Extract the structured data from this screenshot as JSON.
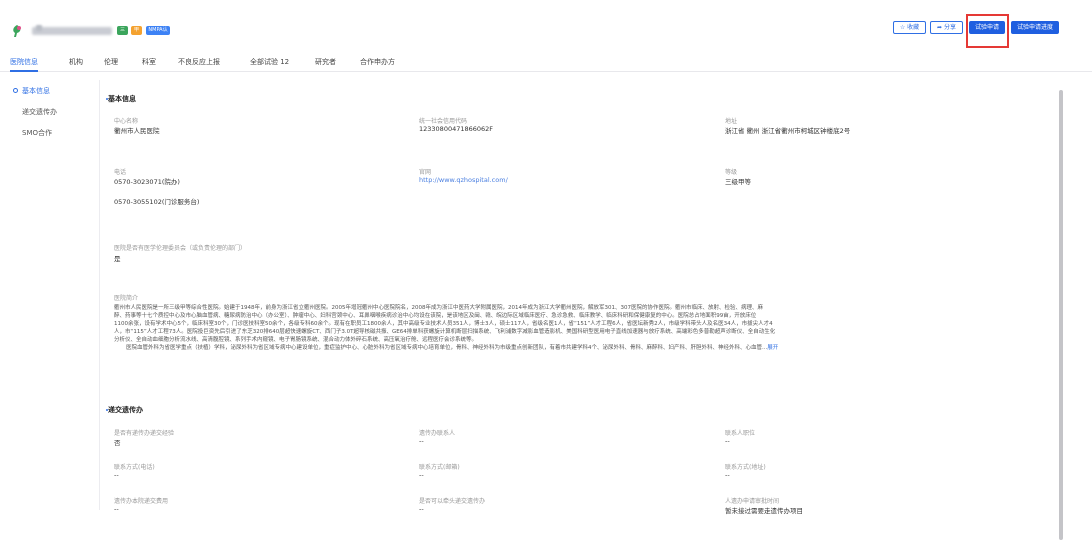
{
  "header": {
    "badges": [
      "三级",
      "甲等",
      "NMPA认定"
    ],
    "buttons": {
      "favorite": "☆ 收藏",
      "share": "➦ 分享",
      "apply": "试验申请",
      "progress": "试验申请进度"
    }
  },
  "tabs": [
    "医院信息",
    "机构",
    "伦理",
    "科室",
    "不良反应上报",
    "全部试验 12",
    "研究者",
    "合作申办方"
  ],
  "sidebar": [
    "基本信息",
    "递交遗传办",
    "SMO合作"
  ],
  "basic": {
    "title": "基本信息",
    "name_label": "中心名称",
    "name_value": "衢州市人民医院",
    "credit_label": "统一社会信用代码",
    "credit_value": "12330800471866062F",
    "address_label": "地址",
    "address_value": "浙江省 衢州 浙江省衢州市柯城区钟楼底2号",
    "phone_label": "电话",
    "phone_value1": "0570-3023071(院办)",
    "phone_value2": "0570-3055102(门诊服务台)",
    "website_label": "官网",
    "website_value": "http://www.qzhospital.com/",
    "level_label": "等级",
    "level_value": "三级甲等",
    "ethics_label": "医院是否有医学伦理委员会（或负责伦理的部门）",
    "ethics_value": "是",
    "intro_label": "医院简介",
    "intro_lines": [
      "衢州市人民医院是一所三级甲等综合性医院。始建于1948年，前身为浙江省立衢州医院。2005年增冠衢州中心医院院名，2008年成为浙江中医药大学附属医院，2014年成为浙江大学衢州医院，解放军301、307医院的协作医院。衢州市临床、放射、检验、病理、麻",
      "醉、药事等十七个质控中心及市心脑血管病、糖尿病防治中心（办公室）、肿瘤中心、妇科宫颈中心、耳鼻咽喉疾病诊治中心均设在该院，是该地区及闽、赣、皖边际区域临床医疗、急诊急救、临床教学、临床科研和保健康复的中心。医院总占地面积99亩，开放床位",
      "1100余张，设有学术中心5个，临床科室30个，门诊医技科室50余个，各级专科60余个。现有在职员工1800余人，其中高级专业技术人员351人，博士3人，硕士117人，省级名医1人，省“151”人才工程6人，省医坛新秀2人，市级学科带头人及名医34人，市拔尖人才4",
      "人，市“115”人才工程73人。医院投巨资先后引进了东芝320排640层超快速螺旋CT、西门子3.0T超导核磁共振、GE64排单科获螺旋计算机断层扫描系统、飞利浦数字减影血管造影机、美国科研型医用电子直线加速器与放疗系统、高端彩色多普勒超声诊断仪、全自动生化",
      "分析仪、全自动血细胞分析流水线、高清腹腔镜、系列手术内窥镜、电子胃肠镜系统、混合动力体外碎石系统、高压氧治疗舱、远程医疗会诊系统等。",
      "医院血管外科为省医学重点（扶植）学科，泌尿外科为省区域专病中心建设单位，重症监护中心、心脏外科为省区域专病中心培育单位，骨科、神经外科为市级重点创新团队，有着市共建学科4个、泌尿外科、骨科、麻醉科、妇产科、肝胆外科、神经外科、心血管..."
    ],
    "expand": "展开"
  },
  "genetic": {
    "title": "递交遗传办",
    "exp_label": "是否有递传办递交经验",
    "exp_value": "否",
    "contact_label": "遗传办联系人",
    "contact_value": "--",
    "position_label": "联系人职位",
    "position_value": "--",
    "phone_label": "联系方式(电话)",
    "phone_value": "--",
    "email_label": "联系方式(邮箱)",
    "email_value": "--",
    "addr_label": "联系方式(地址)",
    "addr_value": "--",
    "fee_label": "遗传办本院递交费用",
    "fee_value": "--",
    "lead_label": "是否可以牵头递交遗传办",
    "lead_value": "--",
    "time_label": "人遗办申请审批时间",
    "time_value": "暂未接过需要走遗传办项目"
  },
  "colors": {
    "primary": "#2f6fe4",
    "highlight": "#e53935"
  }
}
